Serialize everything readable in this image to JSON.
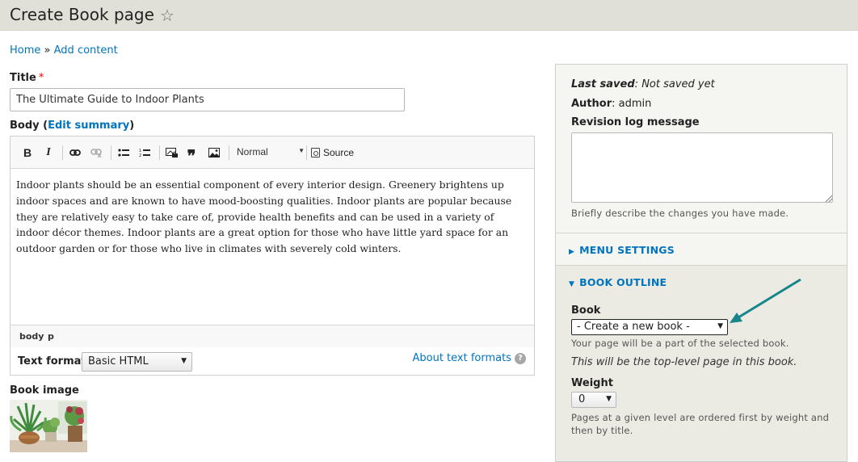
{
  "header": {
    "title": "Create Book page",
    "star_icon": "☆"
  },
  "breadcrumb": {
    "home": "Home",
    "sep": "»",
    "current": "Add content"
  },
  "title_field": {
    "label": "Title",
    "required_mark": "*",
    "value": "The Ultimate Guide to Indoor Plants"
  },
  "body_field": {
    "label": "Body",
    "open_paren": "(",
    "edit_summary": "Edit summary",
    "close_paren": ")",
    "toolbar": {
      "bold": "B",
      "italic": "I",
      "link_icon": "link-icon",
      "unlink_icon": "unlink-icon",
      "bullet_icon": "bulleted-list-icon",
      "numbered_icon": "numbered-list-icon",
      "image_icon": "image-icon",
      "quote": "❞",
      "picture_icon": "picture-icon",
      "format": "Normal",
      "source": "Source"
    },
    "content": "Indoor plants should be an essential component of every interior design. Greenery brightens up indoor spaces and are known to have mood-boosting qualities. Indoor plants are popular because they are relatively easy to take care of, provide health benefits and can be used in a variety of indoor décor themes. Indoor plants are a great option for those who have little yard space for an outdoor garden or for those who live in climates with severely cold winters.",
    "element_path": [
      "body",
      "p"
    ]
  },
  "text_format": {
    "label": "Text format",
    "selected": "Basic HTML",
    "about": "About text formats",
    "help_icon": "?"
  },
  "book_image": {
    "label": "Book image"
  },
  "sidebar": {
    "last_saved_label": "Last saved",
    "last_saved_value": "Not saved yet",
    "author_label": "Author",
    "author_value": "admin",
    "revision_label": "Revision log message",
    "revision_value": "",
    "revision_help": "Briefly describe the changes you have made.",
    "menu_settings": "MENU SETTINGS",
    "book_outline": "BOOK OUTLINE",
    "book_label": "Book",
    "book_selected": "- Create a new book -",
    "book_help": "Your page will be a part of the selected book.",
    "book_note": "This will be the top-level page in this book.",
    "weight_label": "Weight",
    "weight_selected": "0",
    "weight_help": "Pages at a given level are ordered first by weight and then by title."
  },
  "colors": {
    "link": "#0074bd",
    "header_bg": "#e0e0d8",
    "sidebar_bg": "#f5f5f2",
    "arrow": "#17868a"
  }
}
